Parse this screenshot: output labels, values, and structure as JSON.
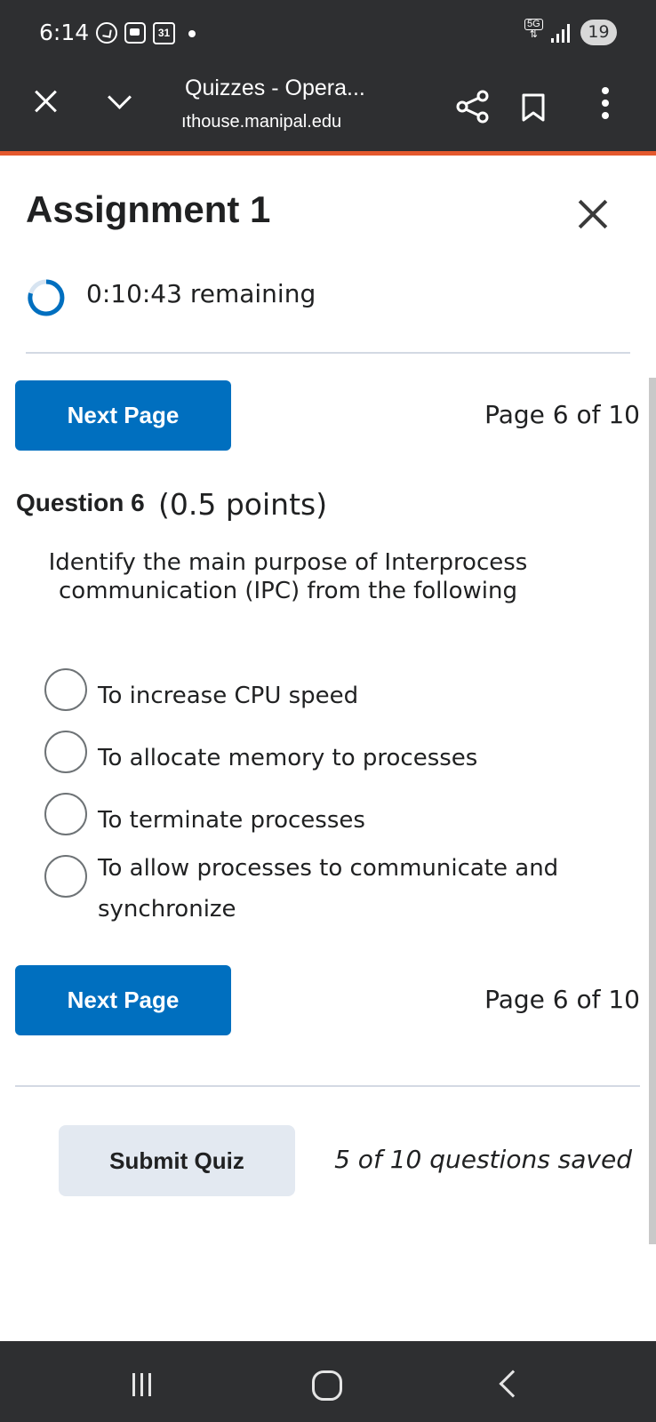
{
  "status_bar": {
    "time": "6:14",
    "calendar_day": "31",
    "network": "5G",
    "battery": "19"
  },
  "browser": {
    "title": "Quizzes - Opera...",
    "url": "ıthouse.manipal.edu"
  },
  "quiz": {
    "title": "Assignment 1",
    "timer": "0:10:43 remaining",
    "next_label": "Next Page",
    "page_info": "Page 6 of 10",
    "question": {
      "title": "Question 6",
      "points": "(0.5 points)",
      "text": "Identify the main purpose of Interprocess communication (IPC) from the following",
      "options": [
        "To increase CPU speed",
        "To allocate memory to processes",
        "To terminate processes",
        "To allow processes to communicate and synchronize"
      ]
    },
    "submit_label": "Submit Quiz",
    "saved_status": "5 of 10 questions saved"
  },
  "colors": {
    "accent_bar": "#e4582d",
    "primary_button": "#006fbf",
    "chrome": "#2e2f31"
  }
}
